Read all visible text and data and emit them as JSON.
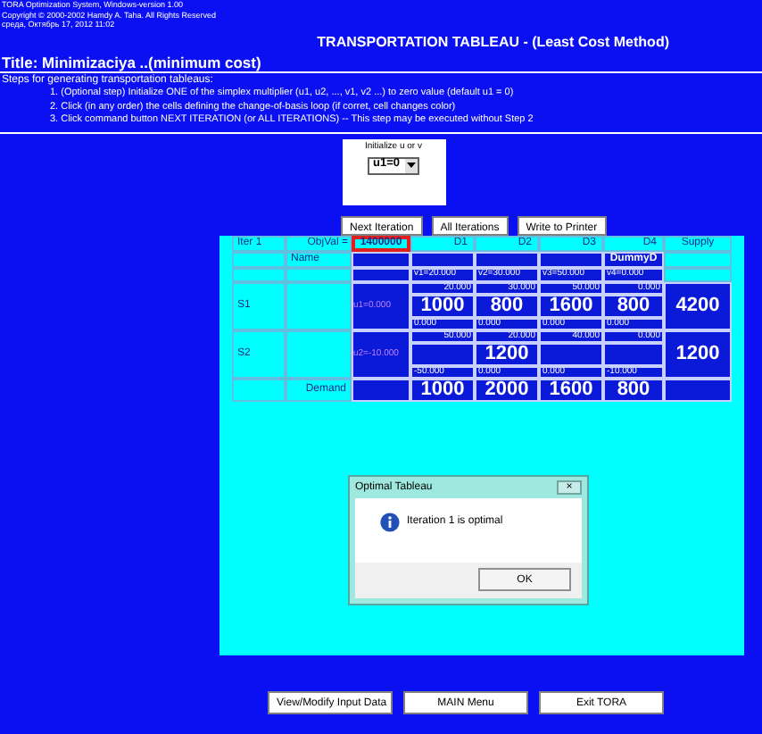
{
  "header_lines": [
    "TORA Optimization System, Windows-version 1.00",
    "Copyright © 2000-2002 Hamdy A. Taha. All Rights Reserved",
    "среда, Октябрь 17, 2012 11:02"
  ],
  "heading": "TRANSPORTATION TABLEAU - (Least Cost Method)",
  "title": "Title: Minimizaciya ..(minimum cost)",
  "steps_heading": "Steps for generating transportation tableaus:",
  "steps": [
    "1.  (Optional step) Initialize ONE of the simplex multiplier (u1, u2, ..., v1, v2 ...) to zero value (default u1 = 0)",
    "2.  Click (in any order) the cells defining the change-of-basis loop (if corret, cell changes color)",
    "3.  Click command button NEXT ITERATION (or ALL ITERATIONS) -- This step may be executed without Step 2"
  ],
  "initialize": {
    "label": "Initialize u or v",
    "value": "u1=0"
  },
  "buttons": [
    "Next Iteration",
    "All Iterations",
    "Write to Printer"
  ],
  "tableau": {
    "iteration": "Iter 1",
    "objval_label": "ObjVal =",
    "objval": "1400000",
    "supply_header": "Supply",
    "name_label": "Name",
    "columns": [
      {
        "label": "D1",
        "v": "v1=20.000"
      },
      {
        "label": "D2",
        "v": "v2=30.000"
      },
      {
        "label": "D3",
        "v": "v3=50.000"
      },
      {
        "label": "D4",
        "name": "DummyD",
        "v": "v4=0.000"
      }
    ],
    "rows": [
      {
        "label": "S1",
        "multiplier": "u1=0.000",
        "supply": "4200",
        "cells": [
          {
            "cost": "20.000",
            "allocation": "1000",
            "reduced": "0.000"
          },
          {
            "cost": "30.000",
            "allocation": "800",
            "reduced": "0.000"
          },
          {
            "cost": "50.000",
            "allocation": "1600",
            "reduced": "0.000"
          },
          {
            "cost": "0.000",
            "allocation": "800",
            "reduced": "0.000"
          }
        ]
      },
      {
        "label": "S2",
        "multiplier": "u2=-10.000",
        "supply": "1200",
        "cells": [
          {
            "cost": "50.000",
            "reduced": "-50.000"
          },
          {
            "cost": "20.000",
            "allocation": "1200",
            "reduced": "0.000"
          },
          {
            "cost": "40.000",
            "reduced": "0.000"
          },
          {
            "cost": "0.000",
            "reduced": "-10.000"
          }
        ]
      }
    ],
    "demand_label": "Demand",
    "demand": [
      "1000",
      "2000",
      "1600",
      "800"
    ]
  },
  "dialog": {
    "title": "Optimal Tableau",
    "close": "×",
    "message": "Iteration 1 is optimal",
    "button": "OK"
  },
  "footer_buttons": [
    "View/Modify Input Data",
    "MAIN Menu",
    "Exit TORA"
  ]
}
